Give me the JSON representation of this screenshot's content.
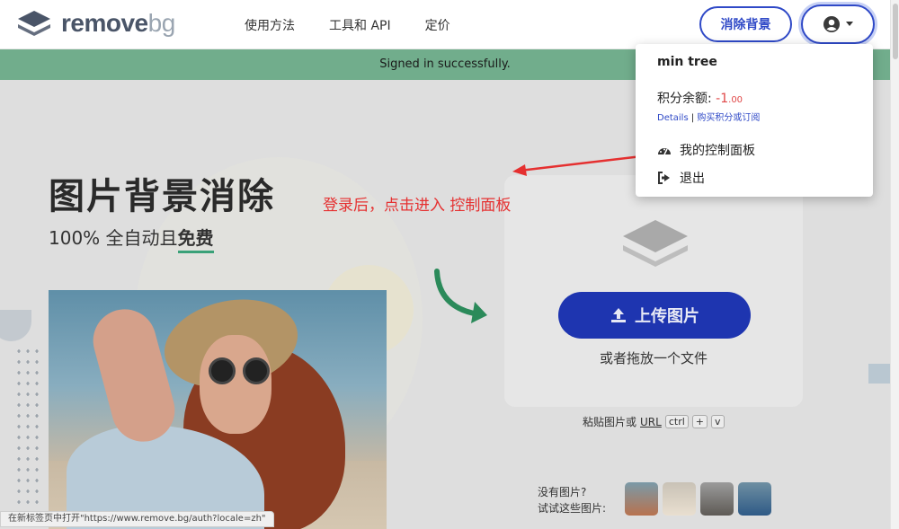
{
  "header": {
    "logo_main": "remove",
    "logo_accent": "bg",
    "nav": [
      "使用方法",
      "工具和 API",
      "定价"
    ],
    "remove_bg_button": "消除背景",
    "user_icon": "user-circle-icon",
    "caret_icon": "caret-down-icon"
  },
  "banner": {
    "text": "Signed in successfully.",
    "color": "#2f8f5b"
  },
  "hero": {
    "title": "图片背景消除",
    "subtitle_prefix": "100% 全自动且",
    "subtitle_emphasis": "免费"
  },
  "upload": {
    "button_label": "上传图片",
    "drop_text": "或者拖放一个文件",
    "paste_prefix": "粘贴图片或",
    "paste_url": "URL",
    "kbd_ctrl": "ctrl",
    "kbd_plus": "+",
    "kbd_v": "v"
  },
  "samples": {
    "line1": "没有图片?",
    "line2": "试试这些图片:"
  },
  "annotation": {
    "text": "登录后，点击进入 控制面板",
    "color": "#e53030"
  },
  "dropdown": {
    "username": "min tree",
    "credits_label": "积分余额:",
    "credits_value": "-1",
    "credits_decimals": ".00",
    "details_link": "Details",
    "separator": "|",
    "buy_link": "购买积分或订阅",
    "dashboard_label": "我的控制面板",
    "dashboard_icon": "dashboard-gauge-icon",
    "logout_label": "退出",
    "logout_icon": "sign-out-icon"
  },
  "status_bar": {
    "text": "在新标签页中打开\"https://www.remove.bg/auth?locale=zh\""
  },
  "colors": {
    "accent": "#2f49c7",
    "upload_button": "#1e35b0",
    "negative": "#e04848"
  }
}
